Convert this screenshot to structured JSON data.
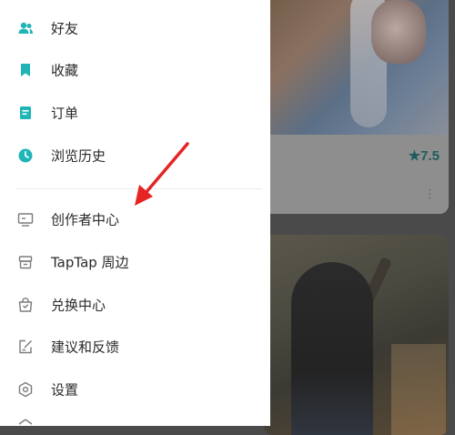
{
  "colors": {
    "accent": "#1fb5b7",
    "secondary_icon": "#7b7b7b",
    "arrow": "#e52424",
    "rating": "#1f5b5f"
  },
  "drawer": {
    "primary_items": [
      {
        "label": "好友",
        "icon": "friends-icon"
      },
      {
        "label": "收藏",
        "icon": "bookmark-icon"
      },
      {
        "label": "订单",
        "icon": "order-icon"
      },
      {
        "label": "浏览历史",
        "icon": "history-clock-icon"
      }
    ],
    "secondary_items": [
      {
        "label": "创作者中心",
        "icon": "monitor-icon"
      },
      {
        "label": "TapTap 周边",
        "icon": "store-icon"
      },
      {
        "label": "兑换中心",
        "icon": "bag-icon"
      },
      {
        "label": "建议和反馈",
        "icon": "feedback-edit-icon"
      },
      {
        "label": "设置",
        "icon": "settings-hexagon-icon"
      }
    ]
  },
  "content": {
    "card1": {
      "rating": "★7.5",
      "more": "⋮"
    }
  }
}
